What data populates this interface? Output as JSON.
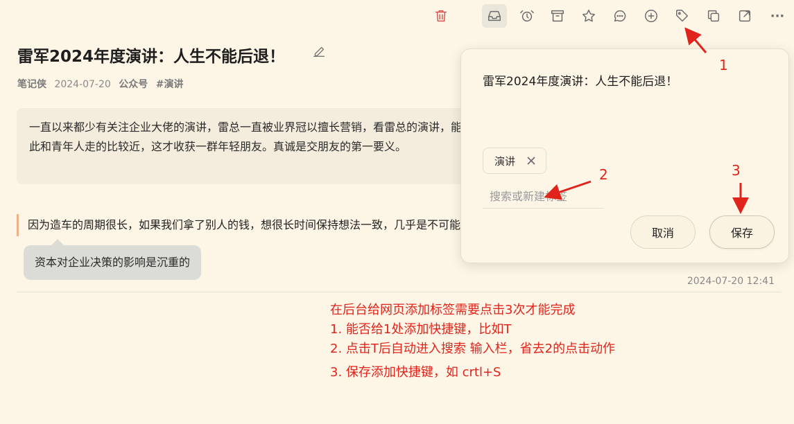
{
  "toolbar": {
    "icons": [
      {
        "name": "trash-icon"
      },
      {
        "name": "inbox-icon"
      },
      {
        "name": "alarm-icon"
      },
      {
        "name": "archive-icon"
      },
      {
        "name": "star-icon"
      },
      {
        "name": "comment-icon"
      },
      {
        "name": "add-circle-icon"
      },
      {
        "name": "tag-icon"
      },
      {
        "name": "copy-icon"
      },
      {
        "name": "share-icon"
      },
      {
        "name": "more-icon"
      }
    ],
    "more_label": "···"
  },
  "article": {
    "title": "雷军2024年度演讲：人生不能后退！",
    "author": "笔记侠",
    "date": "2024-07-20",
    "source": "公众号",
    "tag": "#演讲",
    "summary": "一直以来都少有关注企业大佬的演讲，雷总一直被业界冠以擅长营销，看雷总的演讲，能感受到雷总说话、做事比较真诚，因此和青年人走的比较近，这才收获一群年轻朋友。真诚是交朋友的第一要义。",
    "quote": "因为造车的周期很长，如果我们拿了别人的钱，想很长时间保持想法一致，几乎是不可能的。",
    "note": "资本对企业决策的影响是沉重的",
    "timestamp": "2024-07-20 12:41"
  },
  "popup": {
    "title": "雷军2024年度演讲：人生不能后退！",
    "tag_label": "演讲",
    "input_placeholder": "搜索或新建标签",
    "cancel_label": "取消",
    "save_label": "保存"
  },
  "annotations": {
    "markers": [
      "1",
      "2",
      "3"
    ],
    "lines": [
      "在后台给网页添加标签需要点击3次才能完成",
      "1. 能否给1处添加快捷键，比如T",
      "2. 点击T后自动进入搜索 输入栏，省去2的点击动作",
      "3. 保存添加快捷键，如 crtl+S"
    ]
  },
  "colors": {
    "background": "#fdf6e7",
    "annotation_red": "#e0241b",
    "quote_border": "#eeb08a",
    "trash_red": "#d9534f"
  }
}
